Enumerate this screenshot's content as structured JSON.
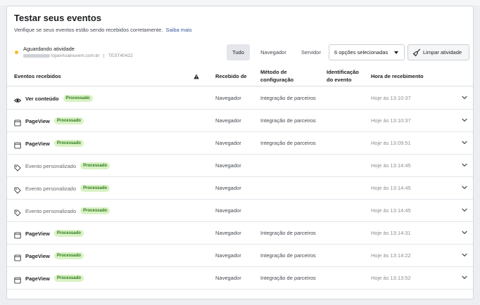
{
  "header": {
    "title": "Testar seus eventos",
    "subtitle": "Verifique se seus eventos estão sendo recebidos corretamente.",
    "learn_more": "Saiba mais"
  },
  "status": {
    "label": "Aguardando atividade",
    "domain": "lojavirtualnuvem.com.br",
    "separator": "|",
    "test_code": "TEST40422",
    "dot_color": "#f7b928"
  },
  "filters": {
    "all": "Tudo",
    "browser": "Navegador",
    "server": "Servidor",
    "selected": "Tudo",
    "options_select": "6 opções selecionadas",
    "clear_label": "Limpar atividade"
  },
  "table": {
    "columns": {
      "events": "Eventos recebidos",
      "received_from_1": "Recebido de",
      "method_1": "Método de",
      "method_2": "configuração",
      "id_1": "Identificação",
      "id_2": "do evento",
      "time": "Hora de recebimento"
    },
    "rows": [
      {
        "icon": "eye-icon",
        "name": "Ver conteúdo",
        "kind": "std",
        "badge": "Processado",
        "received": "Navegador",
        "method": "Integração de parceiros",
        "time": "Hoje às 13:10:37"
      },
      {
        "icon": "window-icon",
        "name": "PageView",
        "kind": "std",
        "badge": "Processado",
        "received": "Navegador",
        "method": "Integração de parceiros",
        "time": "Hoje às 13:10:37"
      },
      {
        "icon": "window-icon",
        "name": "PageView",
        "kind": "std",
        "badge": "Processado",
        "received": "Navegador",
        "method": "Integração de parceiros",
        "time": "Hoje às 13:09:51"
      },
      {
        "icon": "tag-icon",
        "name": "Evento personalizado",
        "kind": "custom",
        "badge": "Processado",
        "received": "Navegador",
        "method": "",
        "time": "Hoje às 13:14:45"
      },
      {
        "icon": "tag-icon",
        "name": "Evento personalizado",
        "kind": "custom",
        "badge": "Processado",
        "received": "Navegador",
        "method": "",
        "time": "Hoje às 13:14:45"
      },
      {
        "icon": "tag-icon",
        "name": "Evento personalizado",
        "kind": "custom",
        "badge": "Processado",
        "received": "Navegador",
        "method": "",
        "time": "Hoje às 13:14:45"
      },
      {
        "icon": "window-icon",
        "name": "PageView",
        "kind": "std",
        "badge": "Processado",
        "received": "Navegador",
        "method": "Integração de parceiros",
        "time": "Hoje às 13:14:31"
      },
      {
        "icon": "window-icon",
        "name": "PageView",
        "kind": "std",
        "badge": "Processado",
        "received": "Navegador",
        "method": "Integração de parceiros",
        "time": "Hoje às 13:14:22"
      },
      {
        "icon": "window-icon",
        "name": "PageView",
        "kind": "std",
        "badge": "Processado",
        "received": "Navegador",
        "method": "Integração de parceiros",
        "time": "Hoje às 13:13:52"
      }
    ]
  },
  "colors": {
    "badge_bg": "#d9f2c4",
    "badge_text": "#2c7a1d",
    "link": "#385898"
  }
}
